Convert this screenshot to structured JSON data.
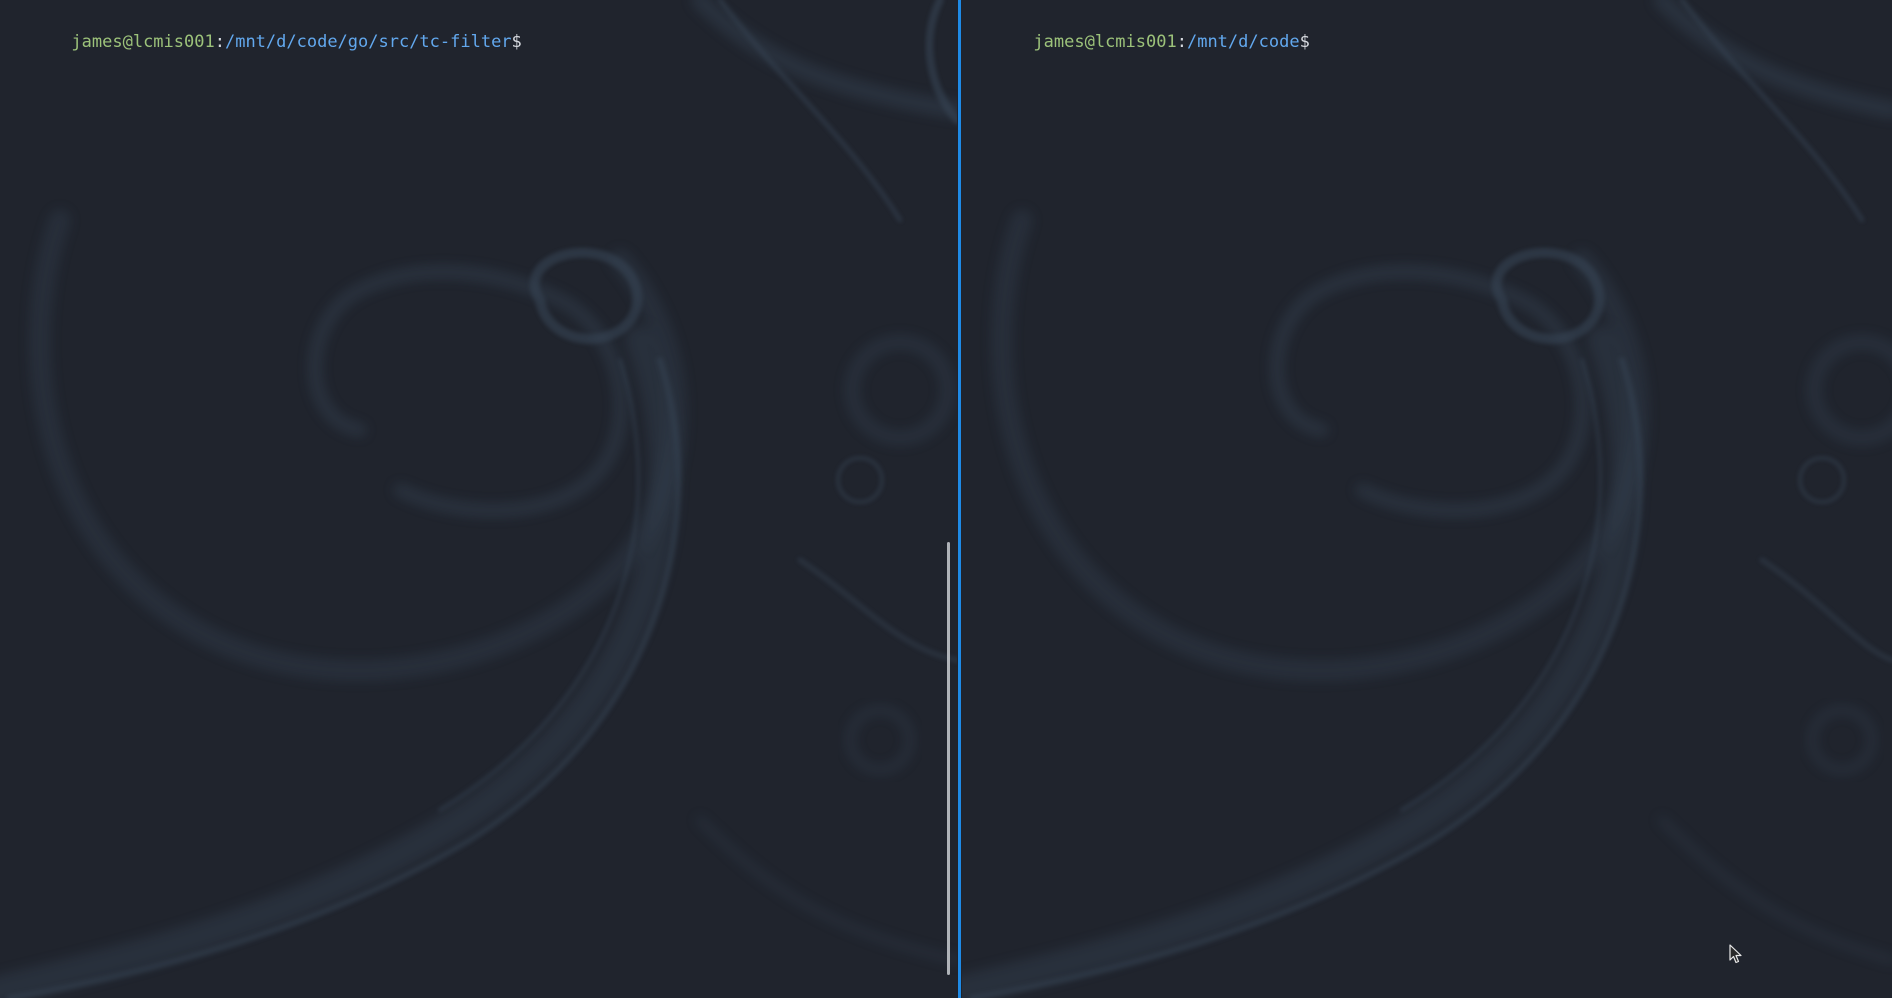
{
  "left_pane": {
    "user_host": "james@lcmis001",
    "separator": ":",
    "path": "/mnt/d/code/go/src/tc-filter",
    "prompt_symbol": "$"
  },
  "right_pane": {
    "user_host": "james@lcmis001",
    "separator": ":",
    "path": "/mnt/d/code",
    "prompt_symbol": "$"
  },
  "colors": {
    "background": "#20242d",
    "user_host": "#9cc27a",
    "path": "#62a8ee",
    "text": "#d7dae0",
    "active_divider": "#1e8ae6",
    "wallpaper_strokes": "#4a5f74"
  },
  "icons": {
    "mouse_pointer": "arrow-cursor-icon"
  }
}
